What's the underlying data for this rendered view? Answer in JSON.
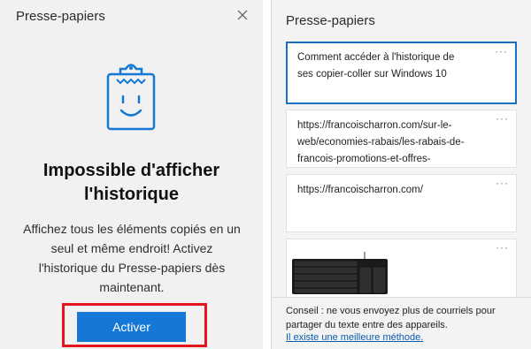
{
  "left_panel": {
    "title": "Presse-papiers",
    "close_icon": "close-icon",
    "illustration_icon": "clipboard-smiley-icon",
    "heading_line1": "Impossible d'afficher",
    "heading_line2": "l'historique",
    "body_lines": [
      "Affichez tous les éléments copiés en un",
      "seul et même endroit! Activez",
      "l'historique du Presse-papiers dès",
      "maintenant."
    ],
    "activate_button": "Activer",
    "colors": {
      "accent": "#1478d4",
      "highlight": "#e3141b",
      "background": "#f1f1f1"
    }
  },
  "right_panel": {
    "title": "Presse-papiers",
    "items": [
      {
        "lines": [
          "Comment accéder à l'historique de",
          "ses copier-coller sur Windows 10"
        ],
        "selected": true,
        "more": "···"
      },
      {
        "lines": [
          "https://francoischarron.com/sur-le-",
          "web/economies-rabais/les-rabais-de-",
          "francois-promotions-et-offres-"
        ],
        "selected": false,
        "more": "···"
      },
      {
        "lines": [
          "https://francoischarron.com/"
        ],
        "selected": false,
        "more": "···"
      },
      {
        "image": "keyboard-image",
        "selected": false,
        "more": "···"
      }
    ],
    "tip": {
      "lines": [
        "Conseil : ne vous envoyez plus de courriels pour",
        "partager du texte entre des appareils."
      ],
      "link": "Il existe une meilleure méthode."
    },
    "colors": {
      "selected_border": "#1a6fc0",
      "link": "#0b5cad"
    }
  }
}
